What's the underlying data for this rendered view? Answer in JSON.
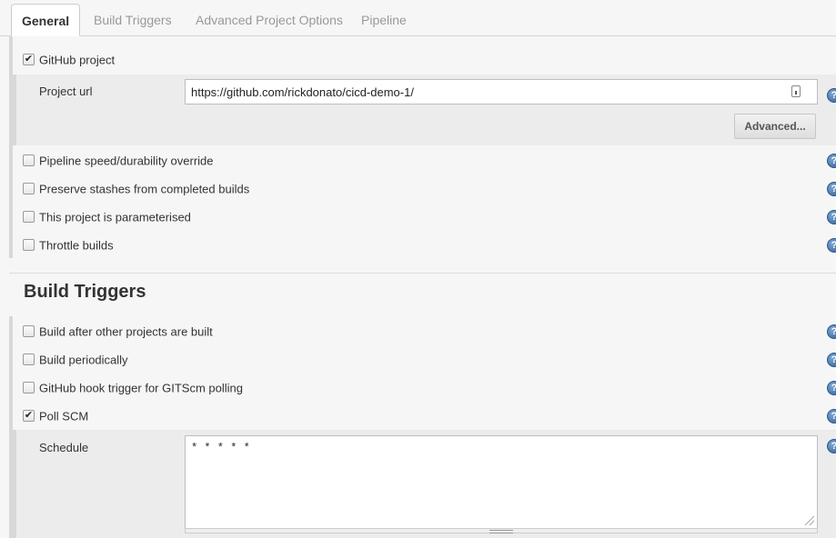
{
  "tabs": [
    {
      "label": "General",
      "active": true
    },
    {
      "label": "Build Triggers",
      "active": false
    },
    {
      "label": "Advanced Project Options",
      "active": false
    },
    {
      "label": "Pipeline",
      "active": false
    }
  ],
  "general": {
    "github_project": {
      "label": "GitHub project",
      "checked": true
    },
    "project_url": {
      "label": "Project url",
      "value": "https://github.com/rickdonato/cicd-demo-1/"
    },
    "advanced_button": "Advanced...",
    "options": [
      {
        "label": "Pipeline speed/durability override",
        "checked": false
      },
      {
        "label": "Preserve stashes from completed builds",
        "checked": false
      },
      {
        "label": "This project is parameterised",
        "checked": false
      },
      {
        "label": "Throttle builds",
        "checked": false
      }
    ]
  },
  "build_triggers": {
    "title": "Build Triggers",
    "options": [
      {
        "label": "Build after other projects are built",
        "checked": false
      },
      {
        "label": "Build periodically",
        "checked": false
      },
      {
        "label": "GitHub hook trigger for GITScm polling",
        "checked": false
      },
      {
        "label": "Poll SCM",
        "checked": true
      }
    ],
    "schedule": {
      "label": "Schedule",
      "value": "* * * * *"
    }
  },
  "icons": {
    "help": "help-icon",
    "checkmark": "✔"
  },
  "colors": {
    "help_blue": "#2d5f96",
    "section_bg": "#f0f0f0",
    "sub_section_bg": "#ececec"
  }
}
